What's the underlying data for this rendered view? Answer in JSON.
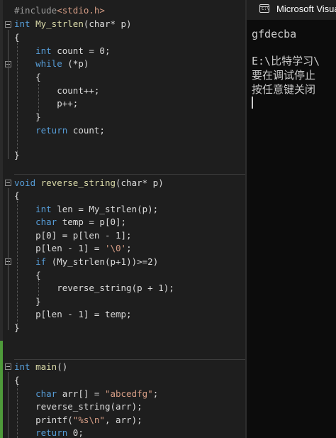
{
  "editor": {
    "tokens": {
      "include_directive": "#include",
      "include_header": "<stdio.h>",
      "int": "int",
      "char": "char",
      "void": "void",
      "while": "while",
      "return": "return",
      "if": "if"
    },
    "fn1": {
      "name": "My_strlen",
      "params": "(char* p)",
      "open": "{",
      "count_decl": " count = 0;",
      "while_cond": " (*p)",
      "while_open": "{",
      "count_inc": "count++;",
      "p_inc": "p++;",
      "while_close": "}",
      "return_val": " count;",
      "close": "}"
    },
    "fn2": {
      "name": "reverse_string",
      "params": "(char* p)",
      "open": "{",
      "len_decl": " len = ",
      "len_call": "My_strlen",
      "len_arg": "(p);",
      "temp_decl": " temp = p[0];",
      "assign1": "p[0] = p[len - 1];",
      "assign2_pre": "p[len - 1] = ",
      "assign2_val": "'\\0'",
      "assign2_post": ";",
      "if_pre": " (",
      "if_call": "My_strlen",
      "if_post": "(p+1))>=2)",
      "if_open": "{",
      "recurse_call": "reverse_string",
      "recurse_args": "(p + 1);",
      "if_close": "}",
      "assign3": "p[len - 1] = temp;",
      "close": "}"
    },
    "fn3": {
      "name": "main",
      "params": "()",
      "open": "{",
      "arr_decl": " arr[] = ",
      "arr_val": "\"abcedfg\"",
      "arr_end": ";",
      "call_rev": "reverse_string",
      "call_rev_args": "(arr);",
      "call_printf": "printf",
      "printf_open": "(",
      "printf_fmt": "\"%s\\n\"",
      "printf_rest": ", arr);",
      "return_val": " 0;"
    }
  },
  "console": {
    "title": "Microsoft Visual",
    "output": "gfdecba",
    "line2": "E:\\比特学习\\",
    "line3": "要在调试停止",
    "line4": "按任意键关闭"
  },
  "colors": {
    "editor_bg": "#1e1e1e",
    "keyword": "#569cd6",
    "string": "#d69d85",
    "console_bg": "#0c0c0c",
    "change_marker": "#4e9a3a"
  }
}
